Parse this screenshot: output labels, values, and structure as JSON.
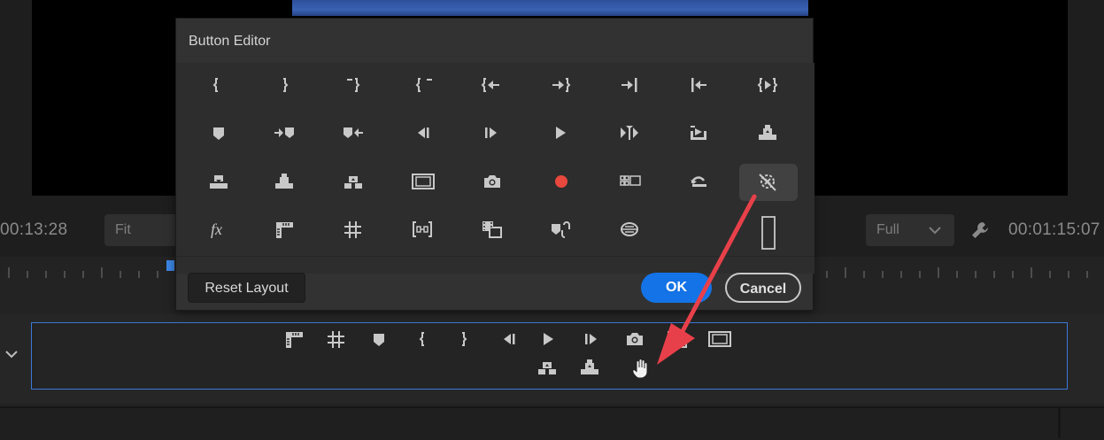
{
  "monitor": {
    "timecode_left": "00:13:28",
    "timecode_right": "00:01:15:07",
    "fit_label": "Fit",
    "full_label": "Full"
  },
  "dialog": {
    "title": "Button Editor",
    "reset_label": "Reset Layout",
    "ok_label": "OK",
    "cancel_label": "Cancel",
    "accent_color": "#1473e6",
    "buttons": [
      [
        "mark-in-icon",
        "mark-out-icon",
        "clear-in-icon",
        "clear-out-icon",
        "go-to-in-icon",
        "go-to-out-icon",
        "go-to-out-point-icon",
        "go-to-in-point-icon",
        "play-in-to-out-icon"
      ],
      [
        "add-marker-icon",
        "go-to-next-marker-icon",
        "go-to-previous-marker-icon",
        "step-back-icon",
        "step-forward-icon",
        "play-icon",
        "shuttle-icon",
        "export-frame-out-icon",
        "lift-icon"
      ],
      [
        "insert-icon",
        "overwrite-icon",
        "extract-icon",
        "safe-margins-icon",
        "camera-icon",
        "record-icon",
        "multi-camera-icon",
        "loop-icon",
        "global-fx-mute-icon"
      ],
      [
        "fx-icon",
        "show-rulers-icon",
        "show-guides-icon",
        "snap-in-program-icon",
        "compare-view-icon",
        "marker-link-icon",
        "vr-video-icon",
        "",
        "spacer-icon"
      ]
    ]
  },
  "strip": {
    "row1": [
      "show-rulers-icon",
      "show-guides-icon",
      "add-marker-icon",
      "mark-in-icon",
      "mark-out-icon",
      "step-back-icon",
      "play-icon",
      "step-forward-icon",
      "camera-icon",
      "compare-view-icon",
      "safe-margins-icon"
    ],
    "row2": [
      "extract-icon",
      "lift-icon",
      "hand-cursor-icon"
    ]
  },
  "annotation": {
    "arrow_color": "#e8404a"
  }
}
